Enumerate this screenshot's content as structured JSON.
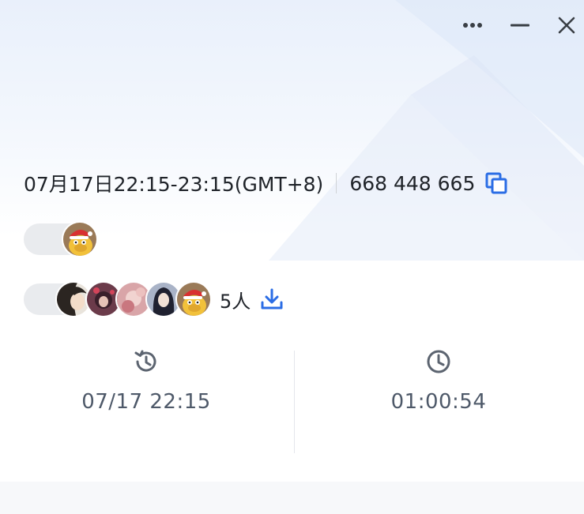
{
  "window": {
    "title": "",
    "more_icon": "more-horizontal-icon",
    "minimize_icon": "minimize-icon",
    "close_icon": "close-icon"
  },
  "meeting": {
    "title": "",
    "time_range": "07月17日22:15-23:15(GMT+8)",
    "meeting_id": "668 448 665",
    "copy_icon": "copy-icon"
  },
  "initiator": {
    "tag_label": "",
    "name": ""
  },
  "participants": {
    "tag_label": "",
    "count_text": "5人",
    "download_icon": "download-icon"
  },
  "stats": {
    "last_join": {
      "value": "07/17 22:15",
      "label": "",
      "icon": "history-icon"
    },
    "duration": {
      "value": "01:00:54",
      "label": "",
      "icon": "clock-icon"
    }
  },
  "colors": {
    "accent": "#2b6de5",
    "text_primary": "#1f2329",
    "text_secondary": "#4e5969",
    "text_muted": "#8f959e",
    "tag_bg": "#e9ebee",
    "background_top": "#e9f0fb"
  }
}
